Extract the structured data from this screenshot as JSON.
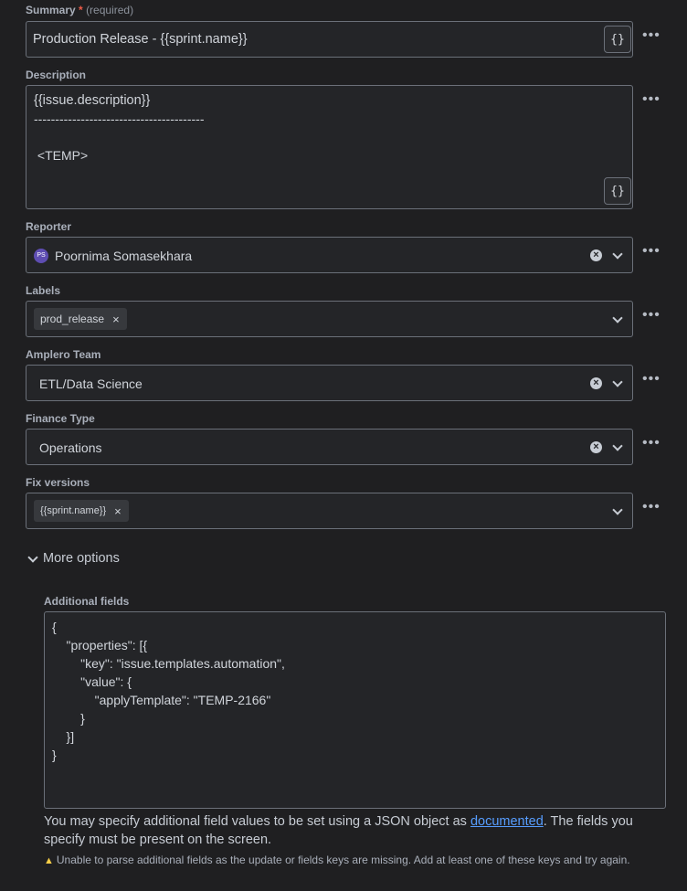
{
  "summary": {
    "label": "Summary",
    "required_star": "*",
    "required_text": "(required)",
    "value": "Production Release - {{sprint.name}}",
    "braces": "{}"
  },
  "description": {
    "label": "Description",
    "lines": [
      "{{issue.description}}",
      "----------------------------------------",
      "",
      " <TEMP>"
    ],
    "braces": "{}"
  },
  "reporter": {
    "label": "Reporter",
    "avatar_initials": "PS",
    "value": "Poornima Somasekhara"
  },
  "labels": {
    "label": "Labels",
    "chips": [
      "prod_release"
    ]
  },
  "team": {
    "label": "Amplero Team",
    "value": "ETL/Data Science"
  },
  "finance": {
    "label": "Finance Type",
    "value": "Operations"
  },
  "fix_versions": {
    "label": "Fix versions",
    "chips": [
      "{{sprint.name}}"
    ]
  },
  "more_dots": "•••",
  "chip_remove": "×",
  "clear_icon": "×",
  "more_options": {
    "label": "More options"
  },
  "additional_fields": {
    "label": "Additional fields",
    "json_lines": [
      "{",
      "    \"properties\": [{",
      "        \"key\": \"issue.templates.automation\",",
      "        \"value\": {",
      "            \"applyTemplate\": \"TEMP-2166\"",
      "        }",
      "    }]",
      "}"
    ],
    "help_before": "You may specify additional field values to be set using a JSON object as ",
    "help_link": "documented",
    "help_after": ". The fields you specify must be present on the screen.",
    "warning_icon": "▲",
    "warning": "Unable to parse additional fields as the update or fields keys are missing. Add at least one of these keys and try again."
  },
  "colors": {
    "background": "#1f1f21",
    "field_border": "#6b7079",
    "link": "#579dff",
    "required": "#ef5c48",
    "warning": "#f5cd47",
    "avatar": "#5e4db2"
  }
}
